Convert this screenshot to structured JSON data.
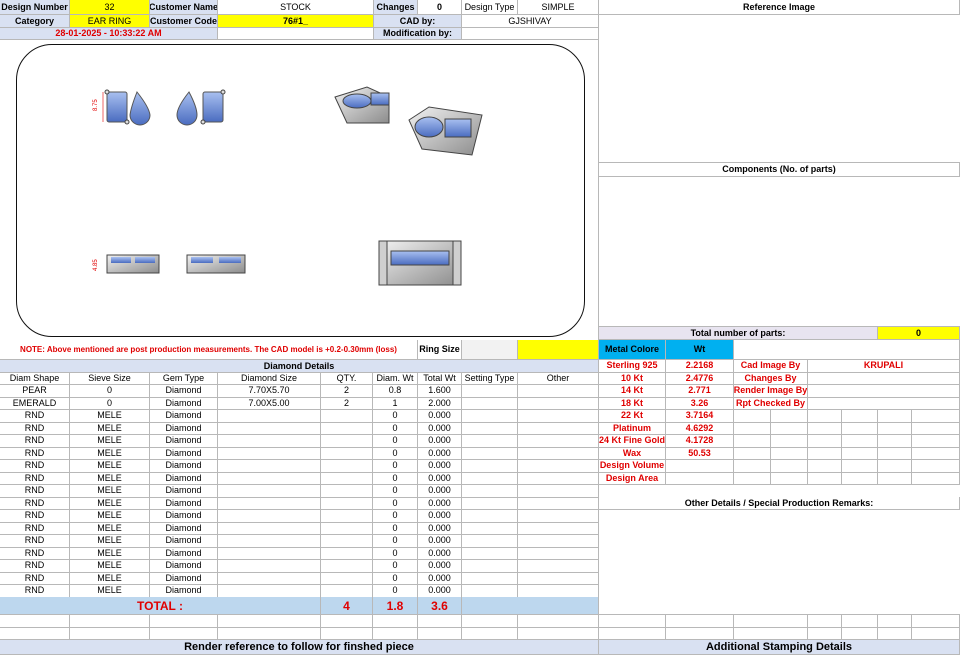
{
  "header": {
    "design_number_label": "Design Number",
    "design_number": "32",
    "customer_name_label": "Customer Name",
    "customer_name": "STOCK",
    "changes_label": "Changes",
    "changes": "0",
    "design_type_label": "Design Type",
    "design_type": "SIMPLE",
    "category_label": "Category",
    "category": "EAR RING",
    "customer_code_label": "Customer Code",
    "customer_code": "76#1_",
    "cad_by_label": "CAD by:",
    "cad_by": "GJSHIVAY",
    "timestamp": "28-01-2025 - 10:33:22 AM",
    "modification_label": "Modification by:",
    "modification": ""
  },
  "render": {
    "dim_top": "8.75",
    "dim_side": "4.85"
  },
  "right_panel": {
    "reference_image": "Reference Image",
    "components": "Components (No. of parts)",
    "total_parts_label": "Total number of parts:",
    "total_parts": "0"
  },
  "note": {
    "text": "NOTE: Above mentioned are post production measurements. The CAD model is +0.2-0.30mm (loss)",
    "ring_size_label": "Ring Size",
    "ring_size": ""
  },
  "diamond": {
    "title": "Diamond Details",
    "columns": [
      "Diam Shape",
      "Sieve Size",
      "Gem Type",
      "Diamond Size",
      "QTY.",
      "Diam. Wt",
      "Total Wt",
      "Setting Type",
      "Other"
    ],
    "rows": [
      [
        "PEAR",
        "0",
        "Diamond",
        "7.70X5.70",
        "2",
        "0.8",
        "1.600",
        "",
        ""
      ],
      [
        "EMERALD",
        "0",
        "Diamond",
        "7.00X5.00",
        "2",
        "1",
        "2.000",
        "",
        ""
      ],
      [
        "RND",
        "MELE",
        "Diamond",
        "",
        "",
        "0",
        "0.000",
        "",
        ""
      ],
      [
        "RND",
        "MELE",
        "Diamond",
        "",
        "",
        "0",
        "0.000",
        "",
        ""
      ],
      [
        "RND",
        "MELE",
        "Diamond",
        "",
        "",
        "0",
        "0.000",
        "",
        ""
      ],
      [
        "RND",
        "MELE",
        "Diamond",
        "",
        "",
        "0",
        "0.000",
        "",
        ""
      ],
      [
        "RND",
        "MELE",
        "Diamond",
        "",
        "",
        "0",
        "0.000",
        "",
        ""
      ],
      [
        "RND",
        "MELE",
        "Diamond",
        "",
        "",
        "0",
        "0.000",
        "",
        ""
      ],
      [
        "RND",
        "MELE",
        "Diamond",
        "",
        "",
        "0",
        "0.000",
        "",
        ""
      ],
      [
        "RND",
        "MELE",
        "Diamond",
        "",
        "",
        "0",
        "0.000",
        "",
        ""
      ],
      [
        "RND",
        "MELE",
        "Diamond",
        "",
        "",
        "0",
        "0.000",
        "",
        ""
      ],
      [
        "RND",
        "MELE",
        "Diamond",
        "",
        "",
        "0",
        "0.000",
        "",
        ""
      ],
      [
        "RND",
        "MELE",
        "Diamond",
        "",
        "",
        "0",
        "0.000",
        "",
        ""
      ],
      [
        "RND",
        "MELE",
        "Diamond",
        "",
        "",
        "0",
        "0.000",
        "",
        ""
      ],
      [
        "RND",
        "MELE",
        "Diamond",
        "",
        "",
        "0",
        "0.000",
        "",
        ""
      ],
      [
        "RND",
        "MELE",
        "Diamond",
        "",
        "",
        "0",
        "0.000",
        "",
        ""
      ],
      [
        "RND",
        "MELE",
        "Diamond",
        "",
        "",
        "0",
        "0.000",
        "",
        ""
      ],
      [
        "RND",
        "MELE",
        "Diamond",
        "",
        "",
        "0",
        "0.000",
        "",
        ""
      ]
    ],
    "total_label": "TOTAL :",
    "total_qty": "4",
    "total_diam_wt": "1.8",
    "total_wt": "3.6"
  },
  "metal": {
    "color_label": "Metal Colore",
    "wt_label": "Wt",
    "rows": [
      [
        "Sterling 925",
        "2.2168"
      ],
      [
        "10 Kt",
        "2.4776"
      ],
      [
        "14 Kt",
        "2.771"
      ],
      [
        "18 Kt",
        "3.26"
      ],
      [
        "22 Kt",
        "3.7164"
      ],
      [
        "Platinum",
        "4.6292"
      ],
      [
        "24 Kt Fine Gold",
        "4.1728"
      ],
      [
        "Wax",
        "50.53"
      ],
      [
        "Design Volume",
        ""
      ],
      [
        "Design Area",
        ""
      ]
    ]
  },
  "credits": {
    "cad_image_label": "Cad Image By",
    "cad_image": "KRUPALI",
    "changes_label": "Changes By",
    "changes": "",
    "render_label": "Render Image By",
    "render": "",
    "rpt_label": "Rpt Checked By",
    "rpt": ""
  },
  "remarks": {
    "title": "Other Details / Special Production Remarks:"
  },
  "footer": {
    "render_reference": "Render reference to follow for finshed piece",
    "stamping": "Additional Stamping Details"
  },
  "colors": {
    "label_bg": "#d9e1f2",
    "highlight": "#ffff00",
    "wt_header": "#00b0f0",
    "metal_header": "#00b0f0",
    "red": "#e00000",
    "stone": "#6f8fd6"
  }
}
